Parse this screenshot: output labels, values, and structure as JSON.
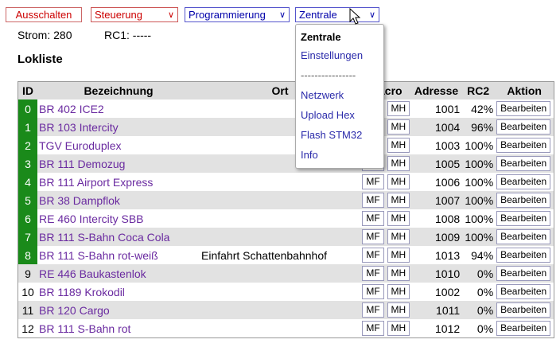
{
  "toolbar": {
    "off_button": "Ausschalten",
    "steuerung": "Steuerung",
    "programmierung": "Programmierung",
    "zentrale": "Zentrale"
  },
  "status": {
    "strom": "Strom: 280",
    "rc1": "RC1: -----"
  },
  "lokliste": {
    "title": "Lokliste",
    "headers": [
      "ID",
      "Bezeichnung",
      "Ort",
      "Macro",
      "Adresse",
      "RC2",
      "Aktion"
    ],
    "mf_label": "MF",
    "mh_label": "MH",
    "edit_label": "Bearbeiten",
    "rows": [
      {
        "id": "0",
        "name": "BR 402 ICE2",
        "ort": "",
        "adresse": "1001",
        "rc2": "42%",
        "active": true
      },
      {
        "id": "1",
        "name": "BR 103 Intercity",
        "ort": "",
        "adresse": "1004",
        "rc2": "96%",
        "active": true
      },
      {
        "id": "2",
        "name": "TGV Euroduplex",
        "ort": "",
        "adresse": "1003",
        "rc2": "100%",
        "active": true
      },
      {
        "id": "3",
        "name": "BR 111 Demozug",
        "ort": "",
        "adresse": "1005",
        "rc2": "100%",
        "active": true
      },
      {
        "id": "4",
        "name": "BR 111 Airport Express",
        "ort": "",
        "adresse": "1006",
        "rc2": "100%",
        "active": true
      },
      {
        "id": "5",
        "name": "BR 38 Dampflok",
        "ort": "",
        "adresse": "1007",
        "rc2": "100%",
        "active": true
      },
      {
        "id": "6",
        "name": "RE 460 Intercity SBB",
        "ort": "",
        "adresse": "1008",
        "rc2": "100%",
        "active": true
      },
      {
        "id": "7",
        "name": "BR 111 S-Bahn Coca Cola",
        "ort": "",
        "adresse": "1009",
        "rc2": "100%",
        "active": true
      },
      {
        "id": "8",
        "name": "BR 111 S-Bahn rot-weiß",
        "ort": "Einfahrt Schattenbahnhof",
        "adresse": "1013",
        "rc2": "94%",
        "active": true
      },
      {
        "id": "9",
        "name": "RE 446 Baukastenlok",
        "ort": "",
        "adresse": "1010",
        "rc2": "0%",
        "active": false
      },
      {
        "id": "10",
        "name": "BR 1189 Krokodil",
        "ort": "",
        "adresse": "1002",
        "rc2": "0%",
        "active": false
      },
      {
        "id": "11",
        "name": "BR 120 Cargo",
        "ort": "",
        "adresse": "1011",
        "rc2": "0%",
        "active": false
      },
      {
        "id": "12",
        "name": "BR 111 S-Bahn rot",
        "ort": "",
        "adresse": "1012",
        "rc2": "0%",
        "active": false
      }
    ]
  },
  "zentrale_menu": {
    "items": [
      "Zentrale",
      "Einstellungen",
      "----------------",
      "Netzwerk",
      "Upload Hex",
      "Flash STM32",
      "Info"
    ]
  },
  "colors": {
    "active_id": "#1a8a1a",
    "name_link": "#6a2aa0",
    "menu_link": "#2a2aaa"
  }
}
